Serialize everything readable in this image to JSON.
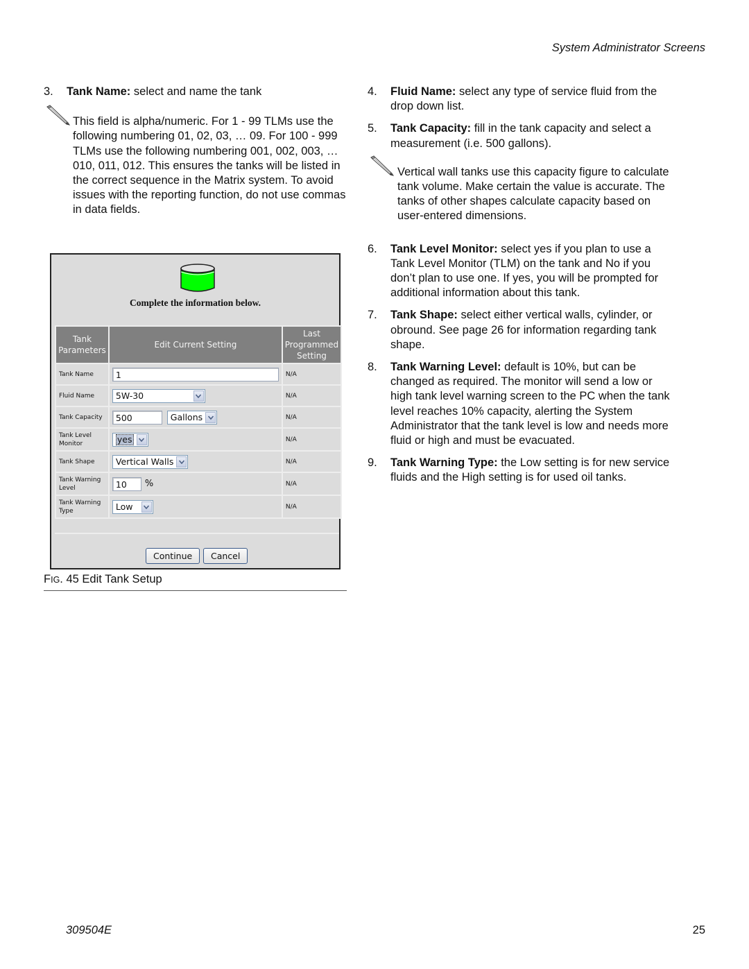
{
  "running_head": "System Administrator Screens",
  "left_column": {
    "item3": {
      "num": "3.",
      "term": "Tank Name:",
      "text": " select and name the tank"
    },
    "note1": "This field is alpha/numeric. For 1 - 99 TLMs use the following numbering 01, 02, 03, … 09. For 100 - 999 TLMs use the following numbering 001, 002, 003, … 010, 011, 012. This ensures the tanks will be listed in the correct sequence in the Matrix system. To avoid issues with the reporting function, do not use commas in data fields."
  },
  "figure": {
    "heading": "Complete the information below.",
    "tank_icon_color": "#00ff00",
    "columns": {
      "param": "Tank Parameters",
      "edit": "Edit Current Setting",
      "last": "Last Programmed Setting"
    },
    "rows": [
      {
        "label": "Tank Name",
        "value": "1",
        "last": "N/A"
      },
      {
        "label": "Fluid Name",
        "value": "5W-30",
        "last": "N/A"
      },
      {
        "label": "Tank Capacity",
        "value": "500",
        "unit": "Gallons",
        "last": "N/A"
      },
      {
        "label": "Tank Level Monitor",
        "value": "yes",
        "last": "N/A"
      },
      {
        "label": "Tank Shape",
        "value": "Vertical Walls",
        "last": "N/A"
      },
      {
        "label": "Tank Warning Level",
        "value": "10",
        "unit": "%",
        "last": "N/A"
      },
      {
        "label": "Tank Warning Type",
        "value": "Low",
        "last": "N/A"
      }
    ],
    "buttons": {
      "continue": "Continue",
      "cancel": "Cancel"
    }
  },
  "caption": {
    "prefix_f": "F",
    "prefix_ig": "IG",
    "rest": ". 45 Edit Tank Setup"
  },
  "right_column": {
    "item4": {
      "num": "4.",
      "term": "Fluid Name:",
      "text": " select any type of service fluid from the drop down list."
    },
    "item5": {
      "num": "5.",
      "term": "Tank Capacity:",
      "text": " fill in the tank capacity and select a measurement (i.e. 500 gallons)."
    },
    "note2": "Vertical wall tanks use this capacity figure to calculate tank volume. Make certain the value is accurate. The tanks of other shapes calculate capacity based on user-entered dimensions.",
    "item6": {
      "num": "6.",
      "term": "Tank Level Monitor:",
      "text": " select yes if you plan to use a Tank Level Monitor (TLM) on the tank and No if you don’t plan to use one. If yes, you will be prompted for additional information about this tank."
    },
    "item7": {
      "num": "7.",
      "term": "Tank Shape:",
      "text": " select either vertical walls, cylinder, or obround. See page 26 for information regarding tank shape."
    },
    "item8": {
      "num": "8.",
      "term": "Tank Warning Level:",
      "text": " default is 10%, but can be changed as required. The monitor will send a low or high tank level warning screen to the PC when the tank level reaches 10% capacity, alerting the System Administrator that the tank level is low and needs more fluid or high and must be evacuated."
    },
    "item9": {
      "num": "9.",
      "term": "Tank Warning Type:",
      "text": " the Low setting is for new service fluids and the High setting is for used oil tanks."
    }
  },
  "footer": {
    "doc_number": "309504E",
    "page_number": "25"
  }
}
